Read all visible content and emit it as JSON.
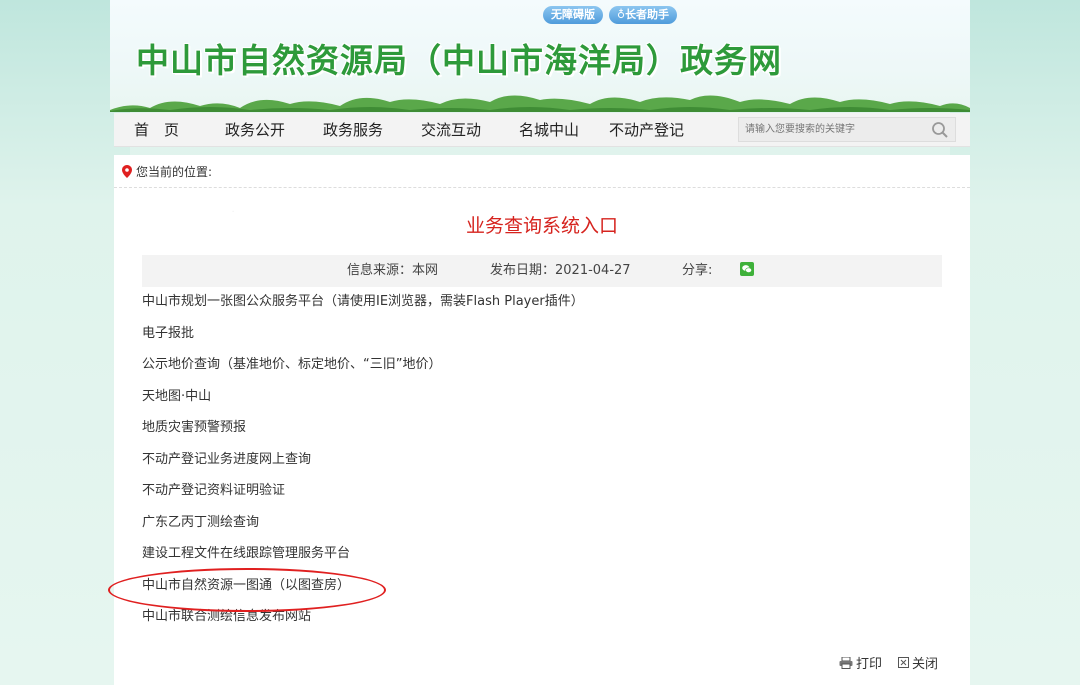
{
  "accessibility": {
    "barrier_free_label": "无障碍版",
    "elder_helper_label": "长者助手"
  },
  "site": {
    "title": "中山市自然资源局（中山市海洋局）政务网"
  },
  "nav": {
    "items": [
      "首　页",
      "政务公开",
      "政务服务",
      "交流互动",
      "名城中山",
      "不动产登记"
    ],
    "search_placeholder": "请输入您要搜索的关键字"
  },
  "breadcrumb": {
    "label": "您当前的位置:"
  },
  "article": {
    "title": "业务查询系统入口",
    "source": "信息来源：本网",
    "date": "发布日期：2021-04-27",
    "share": "分享:"
  },
  "links": [
    "中山市规划一张图公众服务平台（请使用IE浏览器，需装Flash Player插件）",
    "电子报批",
    "公示地价查询（基准地价、标定地价、“三旧”地价）",
    "天地图·中山",
    "地质灾害预警预报",
    "不动产登记业务进度网上查询",
    "不动产登记资料证明验证",
    "广东乙丙丁测绘查询",
    "建设工程文件在线跟踪管理服务平台",
    "中山市自然资源一图通（以图查房）",
    "中山市联合测绘信息发布网站"
  ],
  "actions": {
    "print_label": "打印",
    "close_label": "关闭"
  },
  "colors": {
    "title_green": "#2e9a3a",
    "title_red": "#d6231e",
    "highlight": "#e02020"
  }
}
